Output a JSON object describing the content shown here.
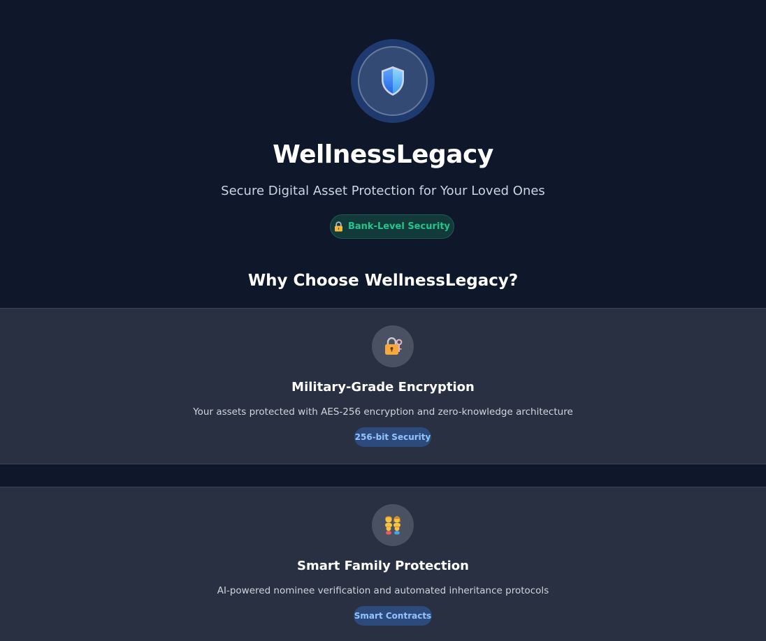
{
  "brand": {
    "logo_icon": "shield-icon",
    "title": "WellnessLegacy",
    "tagline": "Secure Digital Asset Protection for Your Loved Ones",
    "colors": {
      "background": "#0f172a",
      "accent_blue": "#3b82f6",
      "success_green": "#22c58b",
      "card_background": "#283041"
    }
  },
  "security_badge": {
    "icon": "lock-icon",
    "label": "Bank-Level Security"
  },
  "features": {
    "heading": "Why Choose WellnessLegacy?",
    "items": [
      {
        "icon": "lock-with-key-icon",
        "title": "Military-Grade Encryption",
        "description": "Your assets protected with AES-256 encryption and zero-knowledge architecture",
        "badge": "256-bit Security"
      },
      {
        "icon": "family-icon",
        "title": "Smart Family Protection",
        "description": "AI-powered nominee verification and automated inheritance protocols",
        "badge": "Smart Contracts"
      }
    ]
  }
}
